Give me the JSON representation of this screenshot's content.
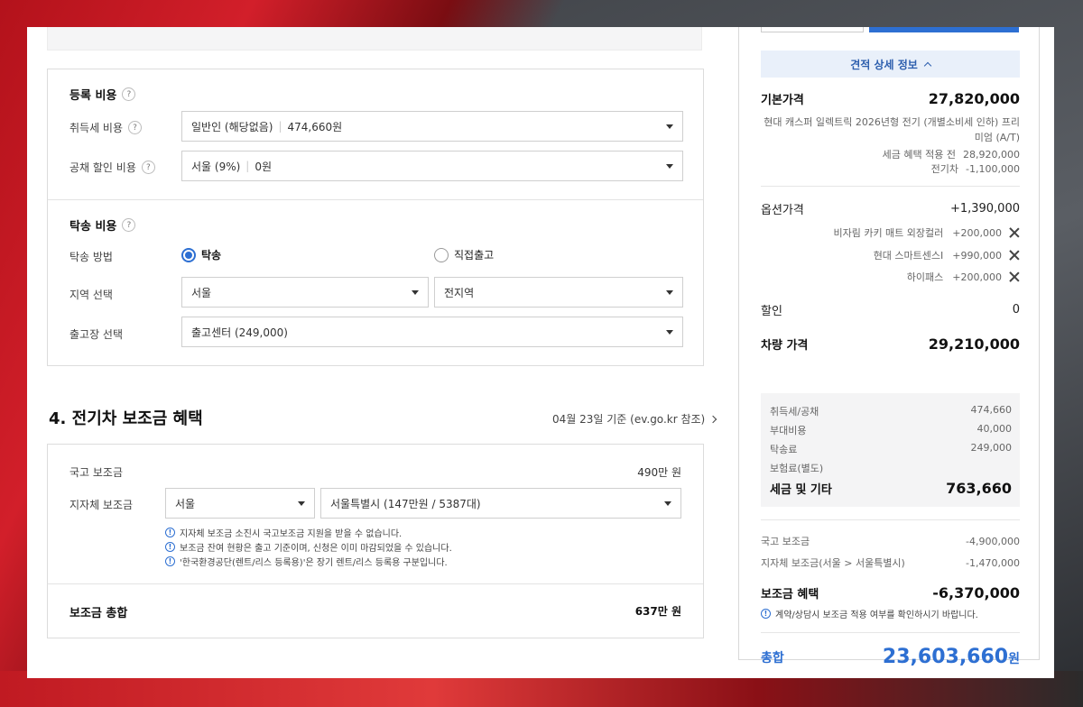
{
  "registration": {
    "title": "등록 비용",
    "acq_tax": {
      "label": "취득세 비용",
      "value": "일반인 (해당없음)",
      "amount": "474,660원"
    },
    "bond": {
      "label": "공채 할인 비용",
      "value": "서울 (9%)",
      "amount": "0원"
    }
  },
  "delivery": {
    "title": "탁송 비용",
    "method": {
      "label": "탁송 방법",
      "option1": "탁송",
      "option2": "직접출고",
      "selected": "탁송"
    },
    "region": {
      "label": "지역 선택",
      "value1": "서울",
      "value2": "전지역"
    },
    "depot": {
      "label": "출고장 선택",
      "value": "출고센터 (249,000)"
    }
  },
  "subsidy": {
    "title": "4. 전기차 보조금 혜택",
    "reference": "04월 23일 기준 (ev.go.kr 참조)",
    "national": {
      "label": "국고 보조금",
      "value": "490만 원"
    },
    "local": {
      "label": "지자체 보조금",
      "city": "서울",
      "detail": "서울특별시 (147만원 / 5387대)"
    },
    "notices": [
      "지자체 보조금 소진시 국고보조금 지원을 받을 수 없습니다.",
      "보조금 잔여 현황은 출고 기준이며, 신청은 이미 마감되었을 수 있습니다.",
      "'한국환경공단(렌트/리스 등록용)'은 장기 렌트/리스 등록용 구분입니다."
    ],
    "total": {
      "label": "보조금 총합",
      "value": "637만 원"
    }
  },
  "summary": {
    "detail_toggle": "견적 상세 정보",
    "base": {
      "label": "기본가격",
      "value": "27,820,000"
    },
    "model": "현대 캐스퍼 일렉트릭 2026년형 전기 (개별소비세 인하) 프리미엄 (A/T)",
    "pre_tax": {
      "label": "세금 혜택 적용 전",
      "value": "28,920,000"
    },
    "ev_discount": {
      "label": "전기차",
      "value": "-1,100,000"
    },
    "options": {
      "label": "옵션가격",
      "value": "+1,390,000"
    },
    "option_items": [
      {
        "name": "비자림 카키 매트 외장컬러",
        "price": "+200,000"
      },
      {
        "name": "현대 스마트센스I",
        "price": "+990,000"
      },
      {
        "name": "하이패스",
        "price": "+200,000"
      }
    ],
    "discount": {
      "label": "할인",
      "value": "0"
    },
    "vehicle": {
      "label": "차량 가격",
      "value": "29,210,000"
    },
    "taxes": [
      {
        "label": "취득세/공채",
        "value": "474,660"
      },
      {
        "label": "부대비용",
        "value": "40,000"
      },
      {
        "label": "탁송료",
        "value": "249,000"
      },
      {
        "label": "보험료(별도)",
        "value": ""
      }
    ],
    "tax_total": {
      "label": "세금 및 기타",
      "value": "763,660"
    },
    "sub_national": {
      "label": "국고 보조금",
      "value": "-4,900,000"
    },
    "sub_local": {
      "label": "지자체 보조금(서울 > 서울특별시)",
      "value": "-1,470,000"
    },
    "sub_total": {
      "label": "보조금 혜택",
      "value": "-6,370,000"
    },
    "sub_notice": "계약/상담시 보조금 적용 여부를 확인하시기 바랍니다.",
    "grand": {
      "label": "총합",
      "value": "23,603,660",
      "unit": "원"
    }
  },
  "colors": {
    "accent": "#2d6fd2"
  }
}
